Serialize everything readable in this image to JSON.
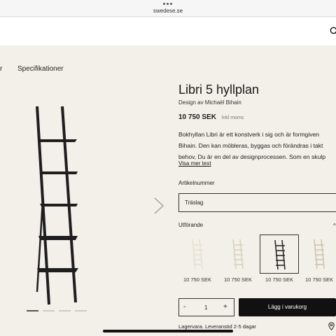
{
  "browser": {
    "url": "swedese.se"
  },
  "tabs": {
    "prev_fragment": "r",
    "specifications": "Specifikationer"
  },
  "product": {
    "title": "Libri 5 hyllplan",
    "designer": "Design av Michaël Bihain",
    "price": "10 750 SEK",
    "vat_note": "Inkl moms",
    "description_lines": [
      "Bokhyllan Libri är ett konstverk i sig och är formgiven",
      "Bihain. Den kan möbleras, byggas och förändras i takt",
      "behov, Du är en del av designprocessen. Som en skulp"
    ],
    "read_more": "Visa mer text"
  },
  "article": {
    "label": "Artikelnummer",
    "value": "Träslag"
  },
  "variants": {
    "label": "Utförande",
    "items": [
      {
        "price": "10 750 SEK",
        "color": "#e8e2d2",
        "selected": false
      },
      {
        "price": "10 750 SEK",
        "color": "#d9d2bd",
        "selected": false
      },
      {
        "price": "10 750 SEK",
        "color": "#2a2a2a",
        "selected": true
      },
      {
        "price": "10 750 SEK",
        "color": "#cfc6ae",
        "selected": false
      }
    ]
  },
  "quantity": {
    "minus": "-",
    "value": "1",
    "plus": "+"
  },
  "cart": {
    "add_label": "Lägg i varukorg"
  },
  "delivery": {
    "text": "Lagervara. Leveranstid 2-5 dagar"
  },
  "icons": {
    "search": "search-icon",
    "next": "chevron-right-icon",
    "pin": "map-pin-icon",
    "menu": "more-dots-icon"
  },
  "colors": {
    "background": "#f3efe9",
    "header": "#ffffff",
    "button": "#111111",
    "ladder_selected": "#2a2a2a"
  }
}
